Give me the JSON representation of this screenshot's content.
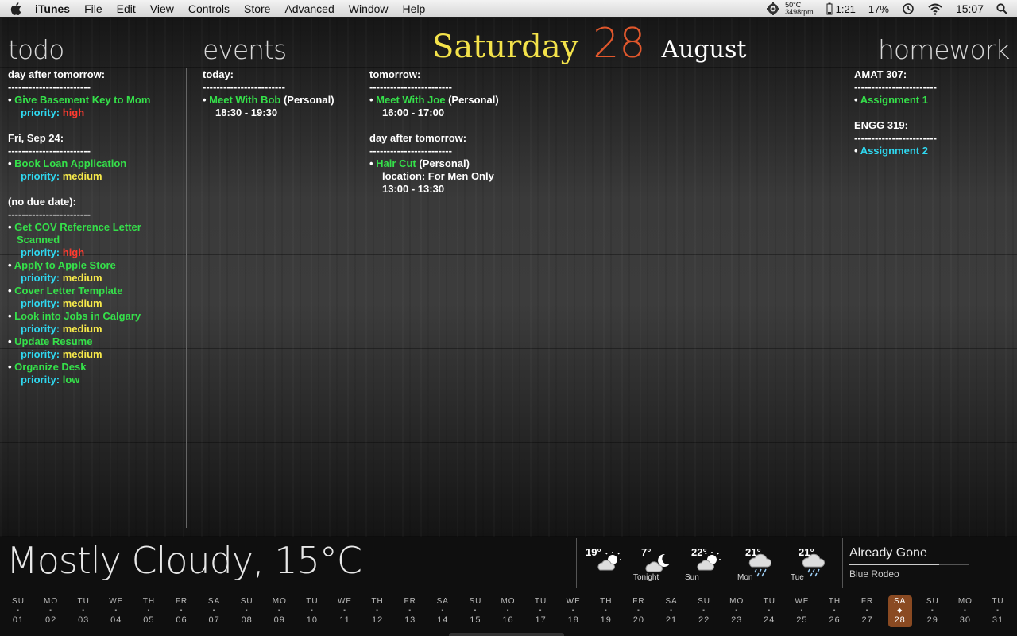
{
  "menubar": {
    "app_name": "iTunes",
    "items": [
      "File",
      "Edit",
      "View",
      "Controls",
      "Store",
      "Advanced",
      "Window",
      "Help"
    ],
    "status": {
      "temp": "50°C",
      "fan": "3498rpm",
      "battery_time": "1:21",
      "percent": "17%",
      "clock": "15:07"
    }
  },
  "titles": {
    "todo": "todo",
    "events": "events",
    "homework": "homework"
  },
  "date": {
    "weekday": "Saturday",
    "day": "28",
    "month": "August"
  },
  "todo": {
    "groups": [
      {
        "heading": "day after tomorrow:",
        "dashes": "------------------------",
        "items": [
          {
            "text": "Give Basement Key to Mom",
            "priority_label": "priority:",
            "priority": "high"
          }
        ]
      },
      {
        "heading": "Fri, Sep 24:",
        "dashes": "------------------------",
        "items": [
          {
            "text": "Book Loan Application",
            "priority_label": "priority:",
            "priority": "medium"
          }
        ]
      },
      {
        "heading": "(no due date):",
        "dashes": "------------------------",
        "items": [
          {
            "text": "Get COV Reference Letter Scanned",
            "priority_label": "priority:",
            "priority": "high"
          },
          {
            "text": "Apply to Apple Store",
            "priority_label": "priority:",
            "priority": "medium"
          },
          {
            "text": "Cover Letter Template",
            "priority_label": "priority:",
            "priority": "medium"
          },
          {
            "text": "Look into Jobs in Calgary",
            "priority_label": "priority:",
            "priority": "medium"
          },
          {
            "text": "Update Resume",
            "priority_label": "priority:",
            "priority": "medium"
          },
          {
            "text": "Organize Desk",
            "priority_label": "priority:",
            "priority": "low"
          }
        ]
      }
    ]
  },
  "events": {
    "today": {
      "heading": "today:",
      "dashes": "------------------------",
      "title": "Meet With Bob",
      "cal": "(Personal)",
      "time": "18:30  - 19:30"
    },
    "tomorrow": {
      "heading": "tomorrow:",
      "dashes": "------------------------",
      "title": "Meet With Joe",
      "cal": "(Personal)",
      "time": "16:00  - 17:00"
    },
    "after": {
      "heading": "day after tomorrow:",
      "dashes": "------------------------",
      "title": "Hair Cut",
      "cal": "(Personal)",
      "location": "location: For Men Only",
      "time": "13:00  - 13:30"
    }
  },
  "homework": [
    {
      "course": "AMAT 307:",
      "dashes": "------------------------",
      "item": "Assignment 1"
    },
    {
      "course": "ENGG 319:",
      "dashes": "------------------------",
      "item": "Assignment 2"
    }
  ],
  "weather": {
    "current": "Mostly Cloudy, 15°C",
    "forecast": [
      {
        "temp": "19°",
        "label": "",
        "icon": "partly-sunny-icon"
      },
      {
        "temp": "7°",
        "label": "Tonight",
        "icon": "night-cloud-icon"
      },
      {
        "temp": "22°",
        "label": "Sun",
        "icon": "partly-sunny-icon"
      },
      {
        "temp": "21°",
        "label": "Mon",
        "icon": "rain-cloud-icon"
      },
      {
        "temp": "21°",
        "label": "Tue",
        "icon": "rain-cloud-icon"
      }
    ]
  },
  "music": {
    "song": "Already Gone",
    "artist": "Blue Rodeo",
    "progress": 0.75
  },
  "calendar": {
    "today": 28,
    "days": [
      {
        "dn": "SU",
        "num": "01"
      },
      {
        "dn": "MO",
        "num": "02"
      },
      {
        "dn": "TU",
        "num": "03"
      },
      {
        "dn": "WE",
        "num": "04"
      },
      {
        "dn": "TH",
        "num": "05"
      },
      {
        "dn": "FR",
        "num": "06"
      },
      {
        "dn": "SA",
        "num": "07"
      },
      {
        "dn": "SU",
        "num": "08"
      },
      {
        "dn": "MO",
        "num": "09"
      },
      {
        "dn": "TU",
        "num": "10"
      },
      {
        "dn": "WE",
        "num": "11"
      },
      {
        "dn": "TH",
        "num": "12"
      },
      {
        "dn": "FR",
        "num": "13"
      },
      {
        "dn": "SA",
        "num": "14"
      },
      {
        "dn": "SU",
        "num": "15"
      },
      {
        "dn": "MO",
        "num": "16"
      },
      {
        "dn": "TU",
        "num": "17"
      },
      {
        "dn": "WE",
        "num": "18"
      },
      {
        "dn": "TH",
        "num": "19"
      },
      {
        "dn": "FR",
        "num": "20"
      },
      {
        "dn": "SA",
        "num": "21"
      },
      {
        "dn": "SU",
        "num": "22"
      },
      {
        "dn": "MO",
        "num": "23"
      },
      {
        "dn": "TU",
        "num": "24"
      },
      {
        "dn": "WE",
        "num": "25"
      },
      {
        "dn": "TH",
        "num": "26"
      },
      {
        "dn": "FR",
        "num": "27"
      },
      {
        "dn": "SA",
        "num": "28"
      },
      {
        "dn": "SU",
        "num": "29"
      },
      {
        "dn": "MO",
        "num": "30"
      },
      {
        "dn": "TU",
        "num": "31"
      }
    ]
  }
}
